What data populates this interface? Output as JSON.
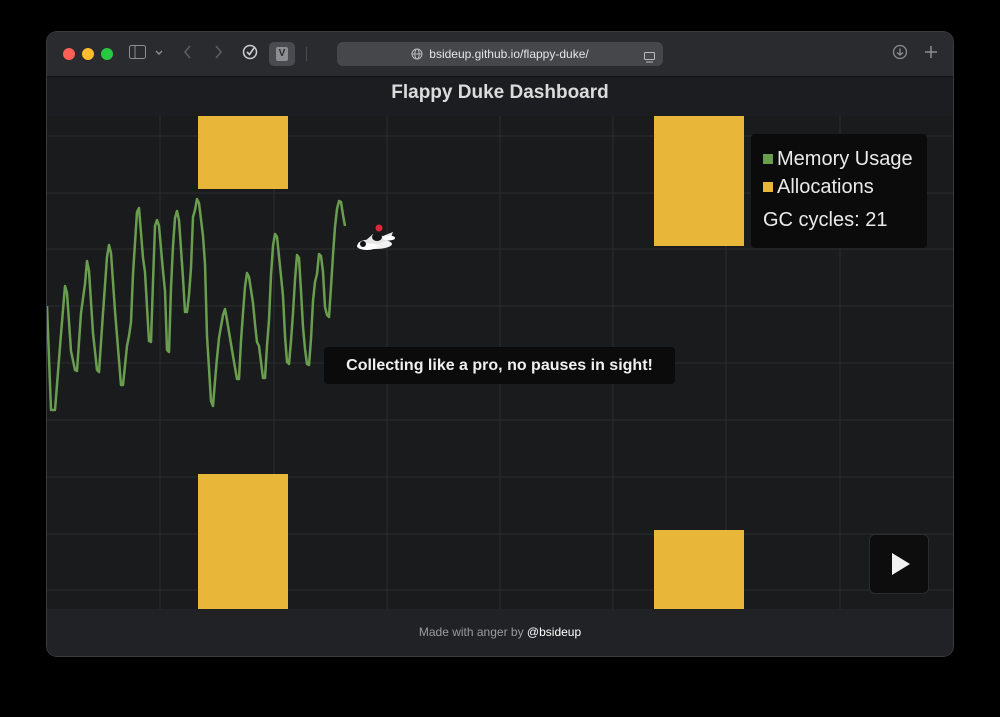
{
  "browser": {
    "url": "bsideup.github.io/flappy-duke/",
    "tab_badge": "V"
  },
  "page": {
    "title": "Flappy Duke Dashboard"
  },
  "legend": {
    "items": [
      {
        "label": "Memory Usage",
        "color": "#6a9e4f"
      },
      {
        "label": "Allocations",
        "color": "#e8b73a"
      }
    ],
    "gc_text": "GC cycles: 21"
  },
  "status_message": "Collecting like a pro, no pauses in sight!",
  "footer": {
    "text": "Made with anger by",
    "link": "@bsideup"
  },
  "colors": {
    "pipe": "#e8b73a",
    "memory_line": "#6a9e4f",
    "grid": "#2a2c2f"
  },
  "icons": {
    "player": "duke-sprite",
    "play_button": "play-icon"
  }
}
